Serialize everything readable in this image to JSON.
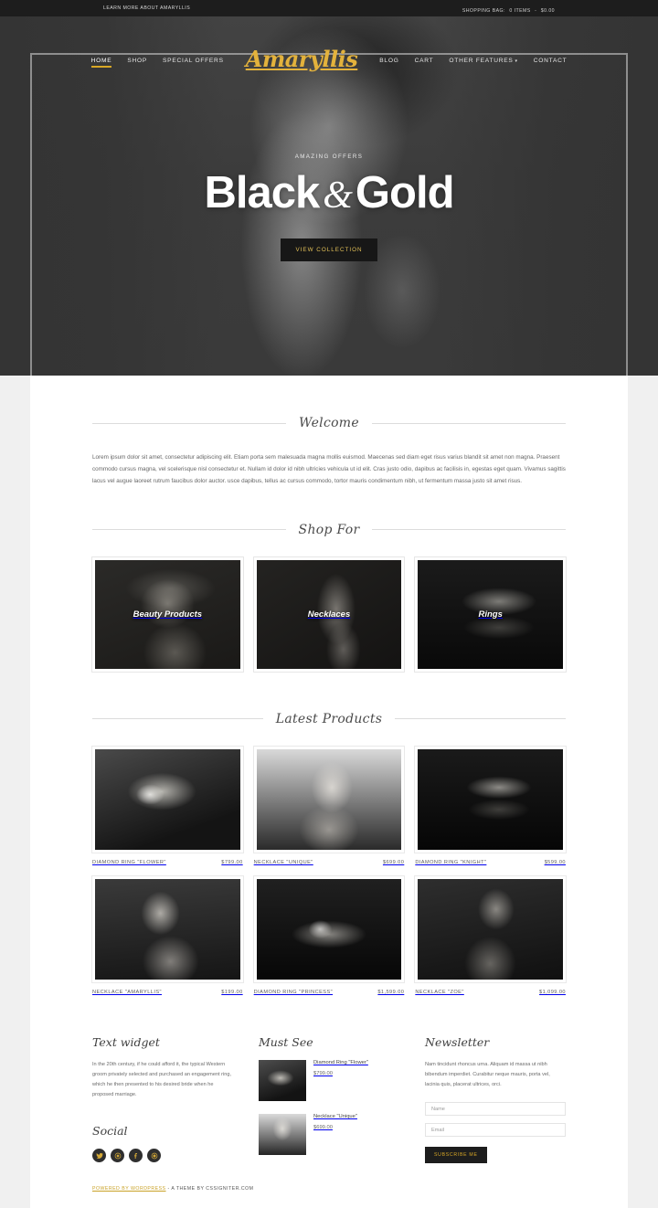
{
  "topbar": {
    "left_link": "LEARN MORE ABOUT AMARYLLIS",
    "bag_label": "SHOPPING BAG:",
    "bag_items": "0 ITEMS",
    "bag_separator": "-",
    "bag_price": "$0.00"
  },
  "brand": {
    "name": "Amaryllis"
  },
  "nav": {
    "left": [
      {
        "label": "HOME",
        "active": true
      },
      {
        "label": "SHOP",
        "active": false
      },
      {
        "label": "SPECIAL OFFERS",
        "active": false
      }
    ],
    "right": [
      {
        "label": "BLOG",
        "active": false
      },
      {
        "label": "CART",
        "active": false
      },
      {
        "label": "OTHER FEATURES",
        "active": false,
        "caret": "▾"
      },
      {
        "label": "CONTACT",
        "active": false
      }
    ]
  },
  "hero": {
    "subtitle": "AMAZING OFFERS",
    "title_part1": "Black",
    "title_amp": "&",
    "title_part2": "Gold",
    "button_label": "VIEW COLLECTION"
  },
  "welcome": {
    "heading": "Welcome",
    "body": "Lorem ipsum dolor sit amet, consectetur adipiscing elit. Etiam porta sem malesuada magna mollis euismod. Maecenas sed diam eget risus varius blandit sit amet non magna. Praesent commodo cursus magna, vel scelerisque nisl consectetur et. Nullam id dolor id nibh ultricies vehicula ut id elit. Cras justo odio, dapibus ac facilisis in, egestas eget quam. Vivamus sagittis lacus vel augue laoreet rutrum faucibus dolor auctor. usce dapibus, tellus ac cursus commodo, tortor mauris condimentum nibh, ut fermentum massa justo sit amet risus."
  },
  "shop_for": {
    "heading": "Shop For",
    "categories": [
      {
        "label": "Beauty Products"
      },
      {
        "label": "Necklaces"
      },
      {
        "label": "Rings"
      }
    ]
  },
  "latest_products": {
    "heading": "Latest Products",
    "items": [
      {
        "name": "DIAMOND RING \"FLOWER\"",
        "price": "$799.00"
      },
      {
        "name": "NECKLACE \"UNIQUE\"",
        "price": "$699.00"
      },
      {
        "name": "DIAMOND RING \"KNIGHT\"",
        "price": "$599.00"
      },
      {
        "name": "NECKLACE \"AMARYLLIS\"",
        "price": "$199.00"
      },
      {
        "name": "DIAMOND RING \"PRINCESS\"",
        "price": "$1,599.00"
      },
      {
        "name": "NECKLACE \"ZOE\"",
        "price": "$1,099.00"
      }
    ]
  },
  "footer": {
    "text_widget": {
      "heading": "Text widget",
      "body": "In the 20th century, if he could afford it, the typical Western groom privately selected and purchased an engagement ring, which he then presented to his desired bride when he proposed marriage."
    },
    "social": {
      "heading": "Social",
      "items": [
        {
          "name": "twitter-icon",
          "glyph": "ᵗ"
        },
        {
          "name": "pinterest-icon",
          "glyph": "Ⓟ"
        },
        {
          "name": "facebook-icon",
          "glyph": "f"
        },
        {
          "name": "google-plus-icon",
          "glyph": "Ⓖ"
        }
      ]
    },
    "must_see": {
      "heading": "Must See",
      "items": [
        {
          "name": "Diamond Ring \"Flower\"",
          "price": "$799.00"
        },
        {
          "name": "Necklace \"Unique\"",
          "price": "$699.00"
        }
      ]
    },
    "newsletter": {
      "heading": "Newsletter",
      "body": "Nam tincidunt rhoncus urna. Aliquam id massa ut nibh bibendum imperdiet. Curabitur neque mauris, porta vel, lacinia quis, placerat ultrices, orci.",
      "name_placeholder": "Name",
      "name_value": "",
      "email_placeholder": "Email",
      "email_value": "",
      "button_label": "SUBSCRIBE ME"
    },
    "copyright_wp": "POWERED BY WORDPRESS",
    "copyright_theme": "- A THEME BY CSSIGNITER.COM"
  },
  "colors": {
    "gold": "#d9a826",
    "dark": "#1d1d1d",
    "hero_bg": "#3a3a3a",
    "text": "#666666"
  }
}
